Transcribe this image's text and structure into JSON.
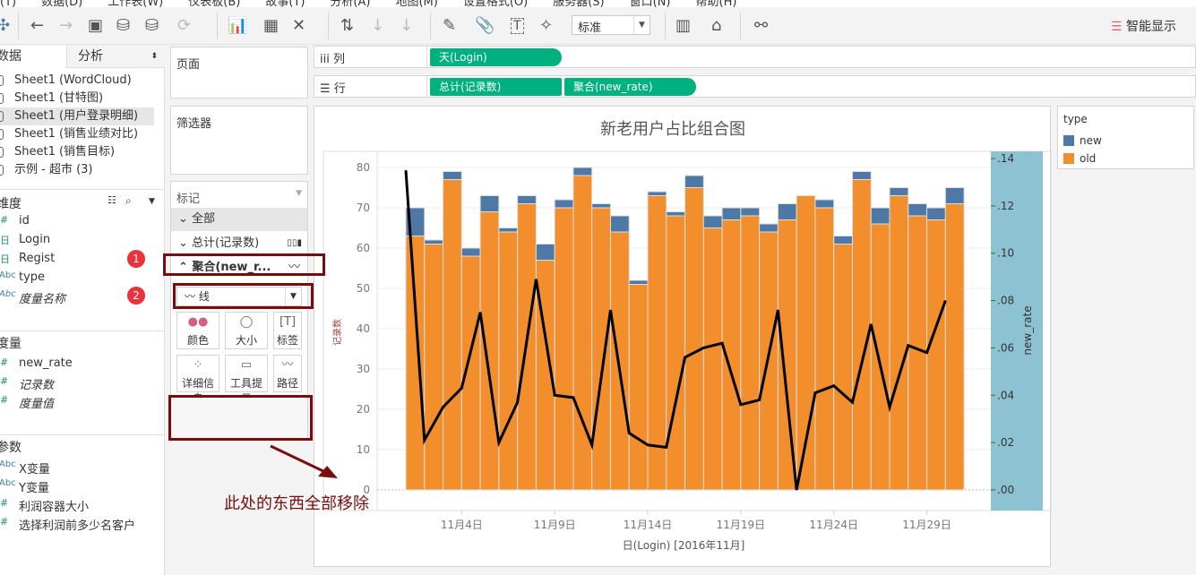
{
  "menu": [
    "(T)",
    "数据(D)",
    "工作表(W)",
    "仪表板(B)",
    "故事(T)",
    "分析(A)",
    "地图(M)",
    "设置格式(O)",
    "服务器(S)",
    "窗口(N)",
    "帮助(H)"
  ],
  "toolbar": {
    "fit_select": "标准",
    "smart_display": "智能显示"
  },
  "left": {
    "tabs": [
      "数据",
      "分析"
    ],
    "datasources": [
      "Sheet1 (WordCloud)",
      "Sheet1 (甘特图)",
      "Sheet1 (用户登录明细)",
      "Sheet1 (销售业绩对比)",
      "Sheet1 (销售目标)",
      "示例 - 超市 (3)"
    ],
    "dimensions_title": "维度",
    "dimensions": [
      {
        "icon": "#",
        "name": "id"
      },
      {
        "icon": "日",
        "name": "Login"
      },
      {
        "icon": "日",
        "name": "Regist"
      },
      {
        "icon": "Abc",
        "name": "type"
      },
      {
        "icon": "Abc",
        "name": "度量名称"
      }
    ],
    "measures_title": "度量",
    "measures": [
      {
        "icon": "#",
        "name": "new_rate"
      },
      {
        "icon": "#",
        "name": "记录数"
      },
      {
        "icon": "#",
        "name": "度量值"
      }
    ],
    "params_title": "参数",
    "params": [
      {
        "icon": "Abc",
        "name": "X变量"
      },
      {
        "icon": "Abc",
        "name": "Y变量"
      },
      {
        "icon": "#",
        "name": "利润容器大小"
      },
      {
        "icon": "#",
        "name": "选择利润前多少名客户"
      }
    ],
    "badges": [
      "1",
      "2"
    ]
  },
  "cards": {
    "pages": "页面",
    "filters": "筛选器",
    "marks": "标记",
    "marks_all": "全部",
    "marks_sum": "总计(记录数)",
    "marks_agg": "聚合(new_r...",
    "mark_type": "线",
    "buttons": [
      "颜色",
      "大小",
      "标签",
      "详细信息",
      "工具提示",
      "路径"
    ]
  },
  "shelves": {
    "columns_label": "列",
    "rows_label": "行",
    "columns": [
      "天(Login)"
    ],
    "rows": [
      "总计(记录数)",
      "聚合(new_rate)"
    ]
  },
  "annotation": "此处的东西全部移除",
  "legend": {
    "title": "type",
    "items": [
      {
        "name": "new",
        "color": "#4e79a7"
      },
      {
        "name": "old",
        "color": "#f28e2b"
      }
    ]
  },
  "chart_data": {
    "type": "bar+line",
    "title": "新老用户占比组合图",
    "xlabel": "日(Login) [2016年11月]",
    "ylabel": "记录数",
    "y2label": "new_rate",
    "ylim": [
      0,
      80
    ],
    "y2lim": [
      0,
      0.14
    ],
    "yticks": [
      "0",
      "10",
      "20",
      "30",
      "40",
      "50",
      "60",
      "70",
      "80"
    ],
    "y2ticks": [
      ".00",
      ".02",
      ".04",
      ".06",
      ".08",
      ".10",
      ".12",
      ".14"
    ],
    "xtick_labels": [
      {
        "day": 4,
        "label": "11月4日"
      },
      {
        "day": 9,
        "label": "11月9日"
      },
      {
        "day": 14,
        "label": "11月14日"
      },
      {
        "day": 19,
        "label": "11月19日"
      },
      {
        "day": 24,
        "label": "11月24日"
      },
      {
        "day": 29,
        "label": "11月29日"
      }
    ],
    "days": [
      1,
      2,
      3,
      4,
      5,
      6,
      7,
      8,
      9,
      10,
      11,
      12,
      13,
      14,
      15,
      16,
      17,
      18,
      19,
      20,
      21,
      22,
      23,
      24,
      25,
      26,
      27,
      28,
      29,
      30
    ],
    "series": [
      {
        "name": "old",
        "color": "#f28e2b",
        "values": [
          63,
          61,
          77,
          58,
          69,
          64,
          71,
          57,
          70,
          78,
          70,
          64,
          51,
          73,
          68,
          75,
          65,
          67,
          68,
          64,
          67,
          73,
          70,
          61,
          77,
          66,
          73,
          68,
          67,
          71
        ]
      },
      {
        "name": "new",
        "color": "#4e79a7",
        "values": [
          7,
          1,
          2,
          2,
          4,
          1,
          2,
          4,
          2,
          2,
          1,
          4,
          1,
          1,
          1,
          3,
          3,
          3,
          2,
          2,
          4,
          0,
          2,
          2,
          2,
          4,
          2,
          3,
          3,
          4
        ]
      },
      {
        "name": "new_rate",
        "color": "#000000",
        "axis": "right",
        "values": [
          0.135,
          0.021,
          0.035,
          0.043,
          0.075,
          0.02,
          0.037,
          0.089,
          0.04,
          0.039,
          0.019,
          0.076,
          0.024,
          0.019,
          0.018,
          0.056,
          0.06,
          0.062,
          0.036,
          0.038,
          0.076,
          0.0,
          0.041,
          0.044,
          0.037,
          0.07,
          0.035,
          0.061,
          0.058,
          0.08
        ]
      }
    ]
  }
}
